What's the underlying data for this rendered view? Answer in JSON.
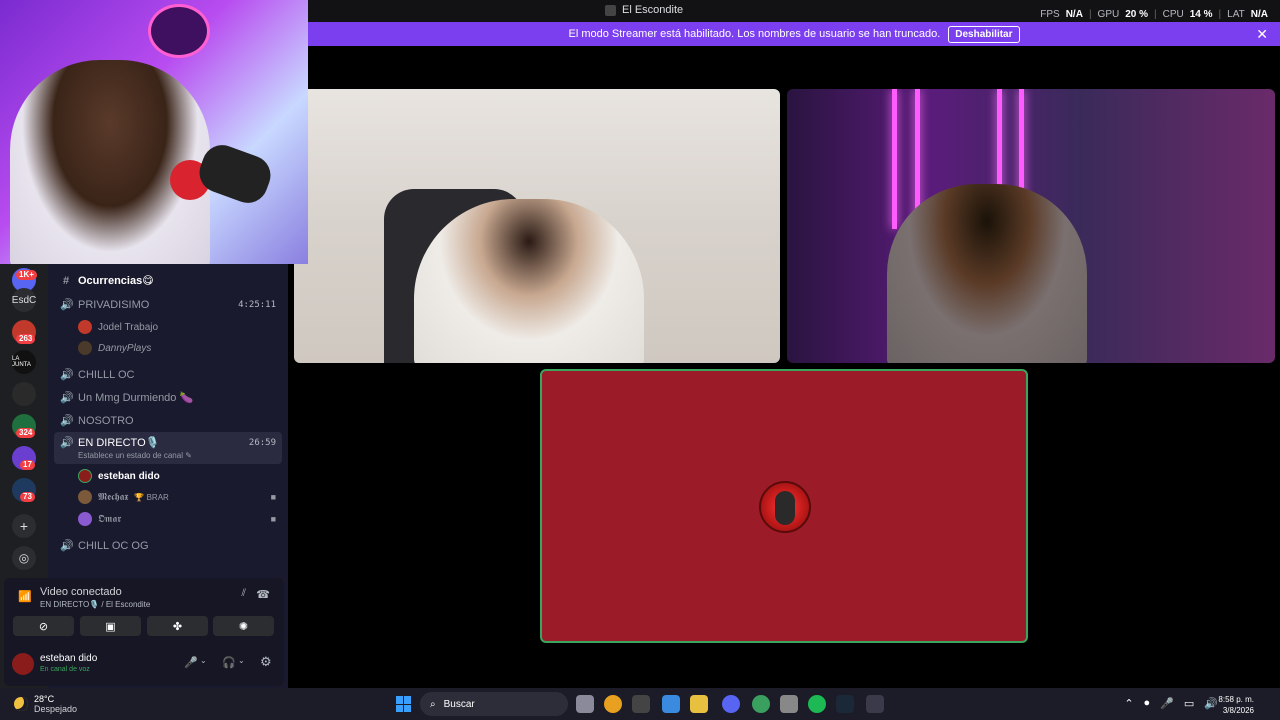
{
  "window": {
    "title": "El Escondite"
  },
  "perf": {
    "fps_label": "FPS",
    "fps_value": "N/A",
    "gpu_label": "GPU",
    "gpu_value": "20 %",
    "cpu_label": "CPU",
    "cpu_value": "14 %",
    "lat_label": "LAT",
    "lat_value": "N/A"
  },
  "banner": {
    "text": "El modo Streamer está habilitado. Los nombres de usuario se han truncado.",
    "button": "Deshabilitar",
    "close": "✕"
  },
  "servers": [
    {
      "label": "1K+",
      "kind": "badge"
    },
    {
      "label": "EsdC",
      "kind": "text"
    },
    {
      "label": "263",
      "kind": "badge"
    },
    {
      "label": "LA JUNTA",
      "kind": "logo"
    },
    {
      "label": "",
      "kind": "logo"
    },
    {
      "label": "324",
      "kind": "badge"
    },
    {
      "label": "17",
      "kind": "badge"
    },
    {
      "label": "73",
      "kind": "badge"
    }
  ],
  "channels": {
    "text_channel": "Ocurrencias😋",
    "privadisimo": {
      "name": "PRIVADISIMO",
      "time": "4:25:11",
      "users": [
        "Jodel Trabajo",
        "DannyPlays"
      ]
    },
    "chilll": "CHILLL OC",
    "mmg": "Un Mmg Durmiendo 🍆",
    "nosotro": "NOSOTRO",
    "directo": {
      "name": "EN DIRECTO🎙️",
      "time": "26:59",
      "status": "Establece un estado de canal",
      "users": [
        "esteban dido",
        "𝕸𝖊𝖈𝖍𝖆𝖝",
        "𝕺𝖒𝖆𝖗"
      ],
      "tag": "🏆 BRAR"
    },
    "chill_og": "CHILL OC OG"
  },
  "voice": {
    "title": "Video conectado",
    "sub": "EN DIRECTO🎙️ / El Escondite"
  },
  "panel_user": {
    "name": "esteban dido",
    "status": "En canal de voz"
  },
  "taskbar": {
    "temp": "28°C",
    "weather": "Despejado",
    "search": "Buscar",
    "time": "8:58 p. m.",
    "date": "3/8/2026"
  },
  "colors": {
    "accent": "#7b3ff0",
    "speaking": "#3ba55d",
    "tile": "#9b1c28"
  }
}
